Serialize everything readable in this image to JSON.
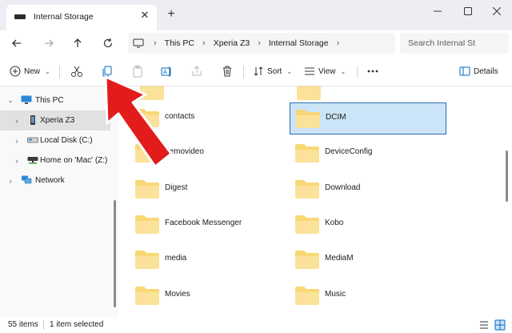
{
  "window": {
    "tab_title": "Internal Storage",
    "new_tab_label": "+",
    "close_tab_label": "✕"
  },
  "address": {
    "breadcrumbs": [
      "This PC",
      "Xperia Z3",
      "Internal Storage"
    ],
    "search_placeholder": "Search Internal St"
  },
  "commands": {
    "new_label": "New",
    "sort_label": "Sort",
    "view_label": "View",
    "details_label": "Details"
  },
  "sidebar": {
    "items": [
      {
        "label": "This PC",
        "icon": "monitor-icon"
      },
      {
        "label": "Xperia Z3",
        "icon": "phone-icon"
      },
      {
        "label": "Local Disk (C:)",
        "icon": "drive-icon"
      },
      {
        "label": "Home on 'Mac' (Z:)",
        "icon": "network-drive-icon"
      },
      {
        "label": "Network",
        "icon": "network-icon"
      }
    ]
  },
  "folders": {
    "left": [
      "contacts",
      "demovideo",
      "Digest",
      "Facebook Messenger",
      "media",
      "Movies"
    ],
    "right": [
      "DCIM",
      "DeviceConfig",
      "Download",
      "Kobo",
      "MediaM",
      "Music"
    ]
  },
  "status": {
    "item_count": "55 items",
    "selection": "1 item selected"
  },
  "colors": {
    "accent": "#0067c0",
    "selection_bg": "#cce4f7",
    "folder": "#f8d775",
    "arrow": "#e21b1b"
  }
}
